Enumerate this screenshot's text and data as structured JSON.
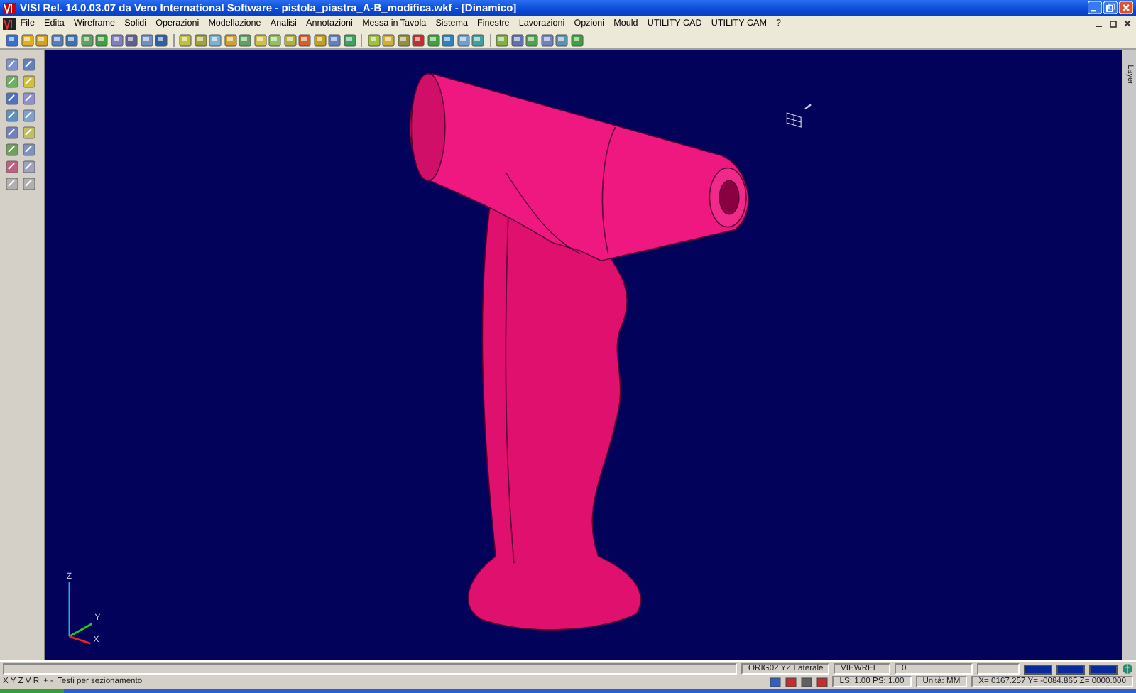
{
  "window": {
    "title": "VISI Rel. 14.0.03.07 da Vero International Software - pistola_piastra_A-B_modifica.wkf - [Dinamico]"
  },
  "menu": [
    "File",
    "Edita",
    "Wireframe",
    "Solidi",
    "Operazioni",
    "Modellazione",
    "Analisi",
    "Annotazioni",
    "Messa in Tavola",
    "Sistema",
    "Finestre",
    "Lavorazioni",
    "Opzioni",
    "Mould",
    "UTILITY CAD",
    "UTILITY CAM",
    "?"
  ],
  "side_panel": {
    "label": "Layer"
  },
  "viewport": {
    "axes": [
      "Z",
      "Y",
      "X"
    ]
  },
  "status_bar": {
    "row_1": [
      "ORIG02 YZ Laterale",
      "VIEWREL",
      "0"
    ],
    "row_2": {
      "axes": "X Y Z V R",
      "keys": "+ -",
      "hint": "Testi per sezionamento",
      "scale": "LS: 1.00 PS: 1.00",
      "units": "Unità: MM",
      "coordinates": "X= 0167.257 Y= -0084.865 Z= 0000.000"
    }
  }
}
